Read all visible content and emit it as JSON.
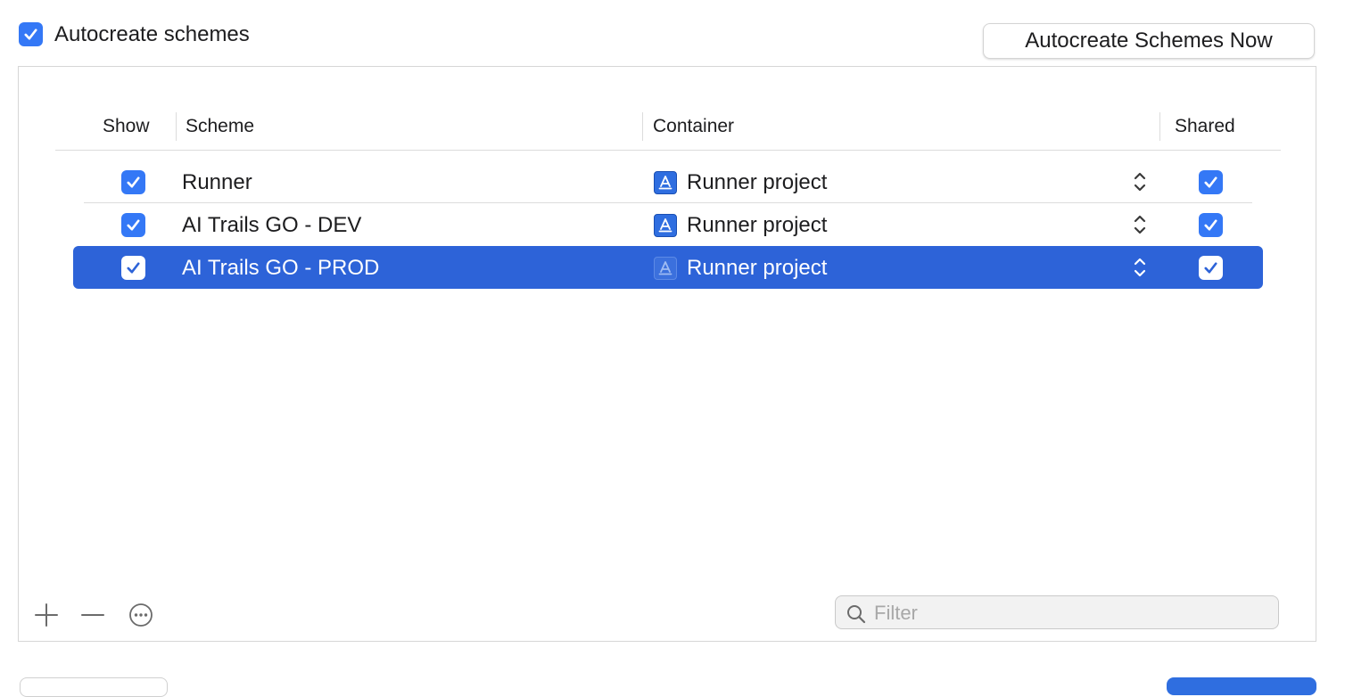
{
  "autocreate": {
    "label": "Autocreate schemes",
    "checked": true
  },
  "toolbar": {
    "autocreate_now_label": "Autocreate Schemes Now"
  },
  "table": {
    "headers": {
      "show": "Show",
      "scheme": "Scheme",
      "container": "Container",
      "shared": "Shared"
    },
    "rows": [
      {
        "show": true,
        "scheme": "Runner",
        "container": "Runner project",
        "shared": true,
        "selected": false
      },
      {
        "show": true,
        "scheme": "AI Trails GO - DEV",
        "container": "Runner project",
        "shared": true,
        "selected": false
      },
      {
        "show": true,
        "scheme": "AI Trails GO - PROD",
        "container": "Runner project",
        "shared": true,
        "selected": true
      }
    ]
  },
  "footer": {
    "add_icon": "plus-icon",
    "remove_icon": "minus-icon",
    "more_icon": "ellipsis-circle-icon",
    "filter_placeholder": "Filter"
  },
  "colors": {
    "accent": "#3478f6",
    "selection": "#2d63d8"
  }
}
